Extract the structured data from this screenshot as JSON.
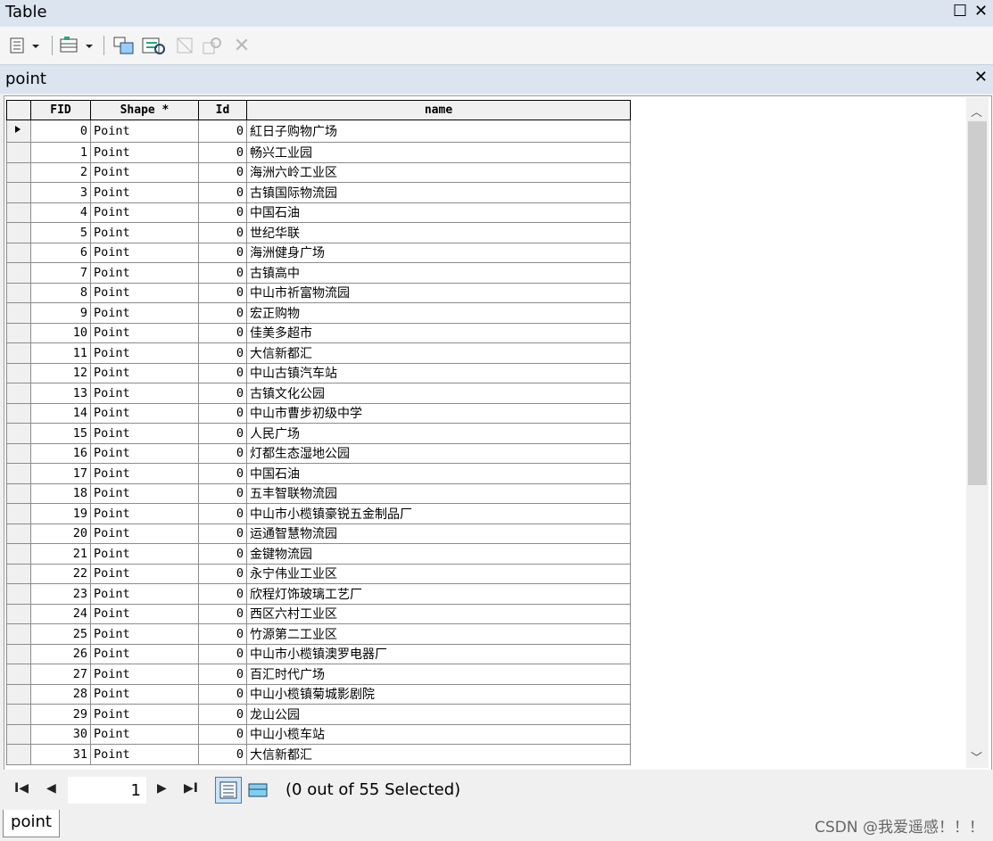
{
  "window": {
    "title": "Table",
    "maximize_label": "☐",
    "close_label": "✕"
  },
  "tab": {
    "label": "point",
    "close_label": "✕"
  },
  "columns": {
    "selector": "",
    "fid": "FID",
    "shape": "Shape *",
    "id": "Id",
    "name": "name"
  },
  "rows": [
    {
      "fid": "0",
      "shape": "Point",
      "id": "0",
      "name": "紅日子购物广场"
    },
    {
      "fid": "1",
      "shape": "Point",
      "id": "0",
      "name": "畅兴工业园"
    },
    {
      "fid": "2",
      "shape": "Point",
      "id": "0",
      "name": "海洲六岭工业区"
    },
    {
      "fid": "3",
      "shape": "Point",
      "id": "0",
      "name": "古镇国际物流园"
    },
    {
      "fid": "4",
      "shape": "Point",
      "id": "0",
      "name": "中国石油"
    },
    {
      "fid": "5",
      "shape": "Point",
      "id": "0",
      "name": "世纪华联"
    },
    {
      "fid": "6",
      "shape": "Point",
      "id": "0",
      "name": "海洲健身广场"
    },
    {
      "fid": "7",
      "shape": "Point",
      "id": "0",
      "name": "古镇高中"
    },
    {
      "fid": "8",
      "shape": "Point",
      "id": "0",
      "name": "中山市祈富物流园"
    },
    {
      "fid": "9",
      "shape": "Point",
      "id": "0",
      "name": "宏正购物"
    },
    {
      "fid": "10",
      "shape": "Point",
      "id": "0",
      "name": "佳美多超市"
    },
    {
      "fid": "11",
      "shape": "Point",
      "id": "0",
      "name": "大信新都汇"
    },
    {
      "fid": "12",
      "shape": "Point",
      "id": "0",
      "name": "中山古镇汽车站"
    },
    {
      "fid": "13",
      "shape": "Point",
      "id": "0",
      "name": "古镇文化公园"
    },
    {
      "fid": "14",
      "shape": "Point",
      "id": "0",
      "name": "中山市曹步初级中学"
    },
    {
      "fid": "15",
      "shape": "Point",
      "id": "0",
      "name": "人民广场"
    },
    {
      "fid": "16",
      "shape": "Point",
      "id": "0",
      "name": "灯都生态湿地公园"
    },
    {
      "fid": "17",
      "shape": "Point",
      "id": "0",
      "name": "中国石油"
    },
    {
      "fid": "18",
      "shape": "Point",
      "id": "0",
      "name": "五丰智联物流园"
    },
    {
      "fid": "19",
      "shape": "Point",
      "id": "0",
      "name": "中山市小榄镇豪锐五金制品厂"
    },
    {
      "fid": "20",
      "shape": "Point",
      "id": "0",
      "name": "运通智慧物流园"
    },
    {
      "fid": "21",
      "shape": "Point",
      "id": "0",
      "name": "金键物流园"
    },
    {
      "fid": "22",
      "shape": "Point",
      "id": "0",
      "name": "永宁伟业工业区"
    },
    {
      "fid": "23",
      "shape": "Point",
      "id": "0",
      "name": "欣程灯饰玻璃工艺厂"
    },
    {
      "fid": "24",
      "shape": "Point",
      "id": "0",
      "name": "西区六村工业区"
    },
    {
      "fid": "25",
      "shape": "Point",
      "id": "0",
      "name": "竹源第二工业区"
    },
    {
      "fid": "26",
      "shape": "Point",
      "id": "0",
      "name": "中山市小榄镇澳罗电器厂"
    },
    {
      "fid": "27",
      "shape": "Point",
      "id": "0",
      "name": "百汇时代广场"
    },
    {
      "fid": "28",
      "shape": "Point",
      "id": "0",
      "name": "中山小榄镇菊城影剧院"
    },
    {
      "fid": "29",
      "shape": "Point",
      "id": "0",
      "name": "龙山公园"
    },
    {
      "fid": "30",
      "shape": "Point",
      "id": "0",
      "name": "中山小榄车站"
    },
    {
      "fid": "31",
      "shape": "Point",
      "id": "0",
      "name": "大信新都汇"
    }
  ],
  "navigation": {
    "current_record": "1",
    "status": "(0 out of 55 Selected)"
  },
  "bottom_tab": {
    "label": "point"
  },
  "watermark": "CSDN @我爱遥感！！！",
  "colors": {
    "title_bar": "#dbe4ef",
    "selected_view": "#cce4f7"
  }
}
